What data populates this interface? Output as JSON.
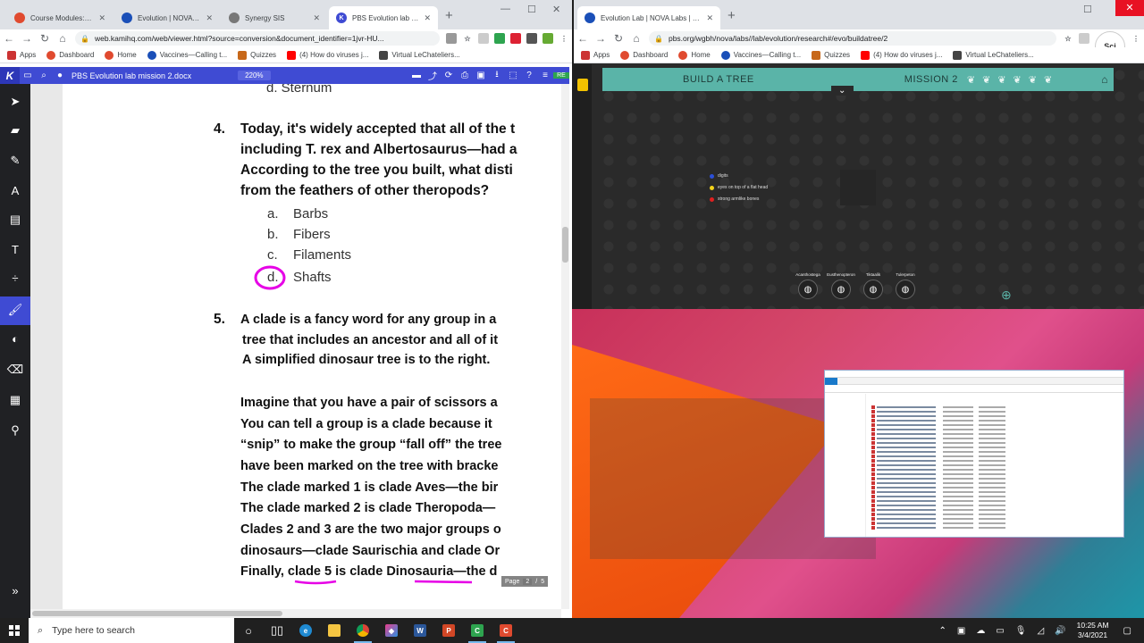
{
  "left_browser": {
    "tabs": [
      {
        "label": "Course Modules: BIOI",
        "color": "#e04a2f"
      },
      {
        "label": "Evolution | NOVA Lab",
        "color": "#1a4fb8"
      },
      {
        "label": "Synergy SIS",
        "color": "#777777"
      },
      {
        "label": "PBS Evolution lab mis",
        "color": "#3f4bd3",
        "active": true
      }
    ],
    "url": "web.kamihq.com/web/viewer.html?source=conversion&document_identifier=1jvr-HU...",
    "bookmarks": [
      "Apps",
      "Dashboard",
      "Home",
      "Vaccines—Calling t...",
      "Quizzes",
      "(4) How do viruses j...",
      "Virtual LeChateliers..."
    ]
  },
  "kami": {
    "logo": "K",
    "doc_title": "PBS Evolution lab mission 2.docx",
    "zoom": "220%",
    "pen_size": "2",
    "colors": [
      "#e600e6",
      "#ff1a1a",
      "#d4900a"
    ],
    "page_current": "2",
    "page_total": "5",
    "page_label": "Page"
  },
  "doc": {
    "prev_option": "d.   Sternum",
    "q4_number": "4.",
    "q4_lines": [
      "Today, it's widely accepted that all of the t",
      "including T. rex and Albertosaurus—had a",
      "According to the tree you built, what disti",
      "from the feathers of other theropods?"
    ],
    "q4_options": [
      {
        "letter": "a.",
        "text": "Barbs"
      },
      {
        "letter": "b.",
        "text": "Fibers"
      },
      {
        "letter": "c.",
        "text": "Filaments"
      },
      {
        "letter": "d.",
        "text": "Shafts"
      }
    ],
    "q5_number": "5.",
    "q5_lines": [
      "A clade is a fancy word for any group in a",
      "tree that includes an ancestor and all of it",
      "A simplified dinosaur tree is to the right."
    ],
    "para_lines": [
      "Imagine that you have a pair of scissors a",
      "You can tell a group is a clade because it",
      "“snip” to make the group “fall off” the tree",
      "have been marked on the tree with bracke",
      "The clade marked 1 is clade Aves—the bir",
      "The clade marked 2 is clade Theropoda—",
      "Clades 2 and 3 are the two major groups o",
      "dinosaurs—clade Saurischia and clade Or",
      "Finally, clade 5 is clade Dinosauria—the d"
    ]
  },
  "right_browser": {
    "tab_label": "Evolution Lab | NOVA Labs | PBS",
    "tab_color": "#1a4fb8",
    "url": "pbs.org/wgbh/nova/labs//lab/evolution/research#/evo/buildatree/2",
    "bookmarks": [
      "Apps",
      "Dashboard",
      "Home",
      "Vaccines—Calling t...",
      "Quizzes",
      "(4) How do viruses j...",
      "Virtual LeChateliers..."
    ]
  },
  "lab": {
    "build_tree": "BUILD A TREE",
    "mission": "MISSION 2",
    "legend": [
      {
        "label": "digits",
        "color": "#2b4fd8"
      },
      {
        "label": "eyes on top of a flat head",
        "color": "#f2d21a"
      },
      {
        "label": "strong armlike bones",
        "color": "#e02020"
      }
    ],
    "taxa": [
      "Acanthostega",
      "Eusthenopteron",
      "Tiktaalik",
      "Tulerpeton"
    ]
  },
  "taskbar": {
    "search_placeholder": "Type here to search",
    "time": "10:25 AM",
    "date": "3/4/2021"
  }
}
